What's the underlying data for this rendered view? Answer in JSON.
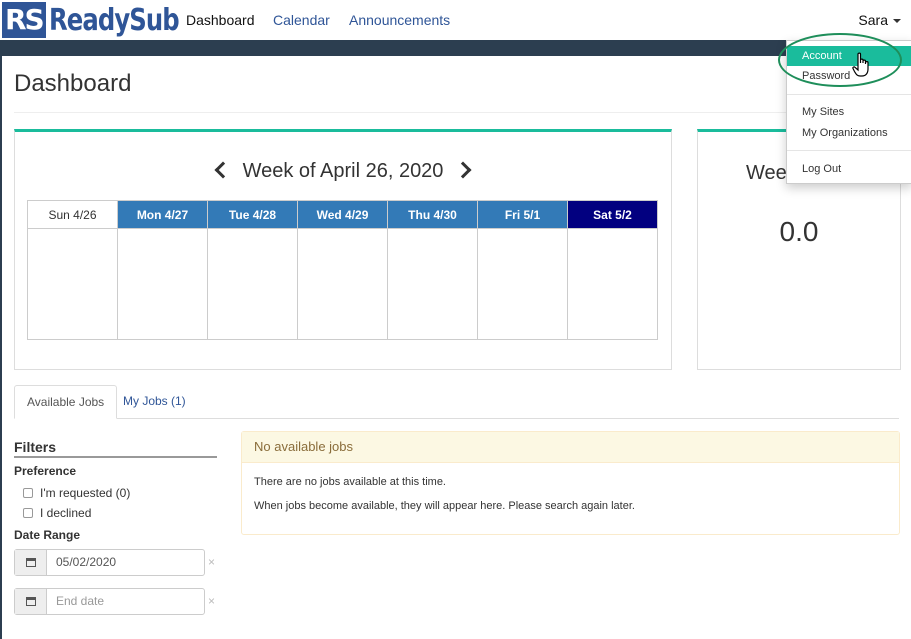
{
  "brand": {
    "box": "RS",
    "name": "ReadySub"
  },
  "nav": {
    "links": [
      {
        "label": "Dashboard"
      },
      {
        "label": "Calendar"
      },
      {
        "label": "Announcements"
      }
    ],
    "user": "Sara"
  },
  "page": {
    "title": "Dashboard"
  },
  "week": {
    "title": "Week of April 26, 2020",
    "days": [
      "Sun 4/26",
      "Mon 4/27",
      "Tue 4/28",
      "Wed 4/29",
      "Thu 4/30",
      "Fri 5/1",
      "Sat 5/2"
    ],
    "summary_label": "Wee",
    "summary_value": "0.0"
  },
  "tabs": [
    {
      "label": "Available Jobs"
    },
    {
      "label": "My Jobs (1)"
    }
  ],
  "filters": {
    "title": "Filters",
    "preference_label": "Preference",
    "options": [
      {
        "label": "I'm requested (0)"
      },
      {
        "label": "I declined"
      }
    ],
    "date_range_label": "Date Range",
    "start_date": "05/02/2020",
    "end_placeholder": "End date",
    "clear_icon": "×"
  },
  "jobs": {
    "header": "No available jobs",
    "line1": "There are no jobs available at this time.",
    "line2": "When jobs become available, they will appear here. Please search again later."
  },
  "dropdown": {
    "items": [
      {
        "label": "Account"
      },
      {
        "label": "Password"
      },
      {
        "label": "My Sites"
      },
      {
        "label": "My Organizations"
      },
      {
        "label": "Log Out"
      }
    ]
  },
  "colors": {
    "brand": "#2f5597",
    "accent": "#1abc9c",
    "weekday_header": "#337ab7",
    "saturday_header": "#020080",
    "warning_bg": "#fcf8e3"
  }
}
